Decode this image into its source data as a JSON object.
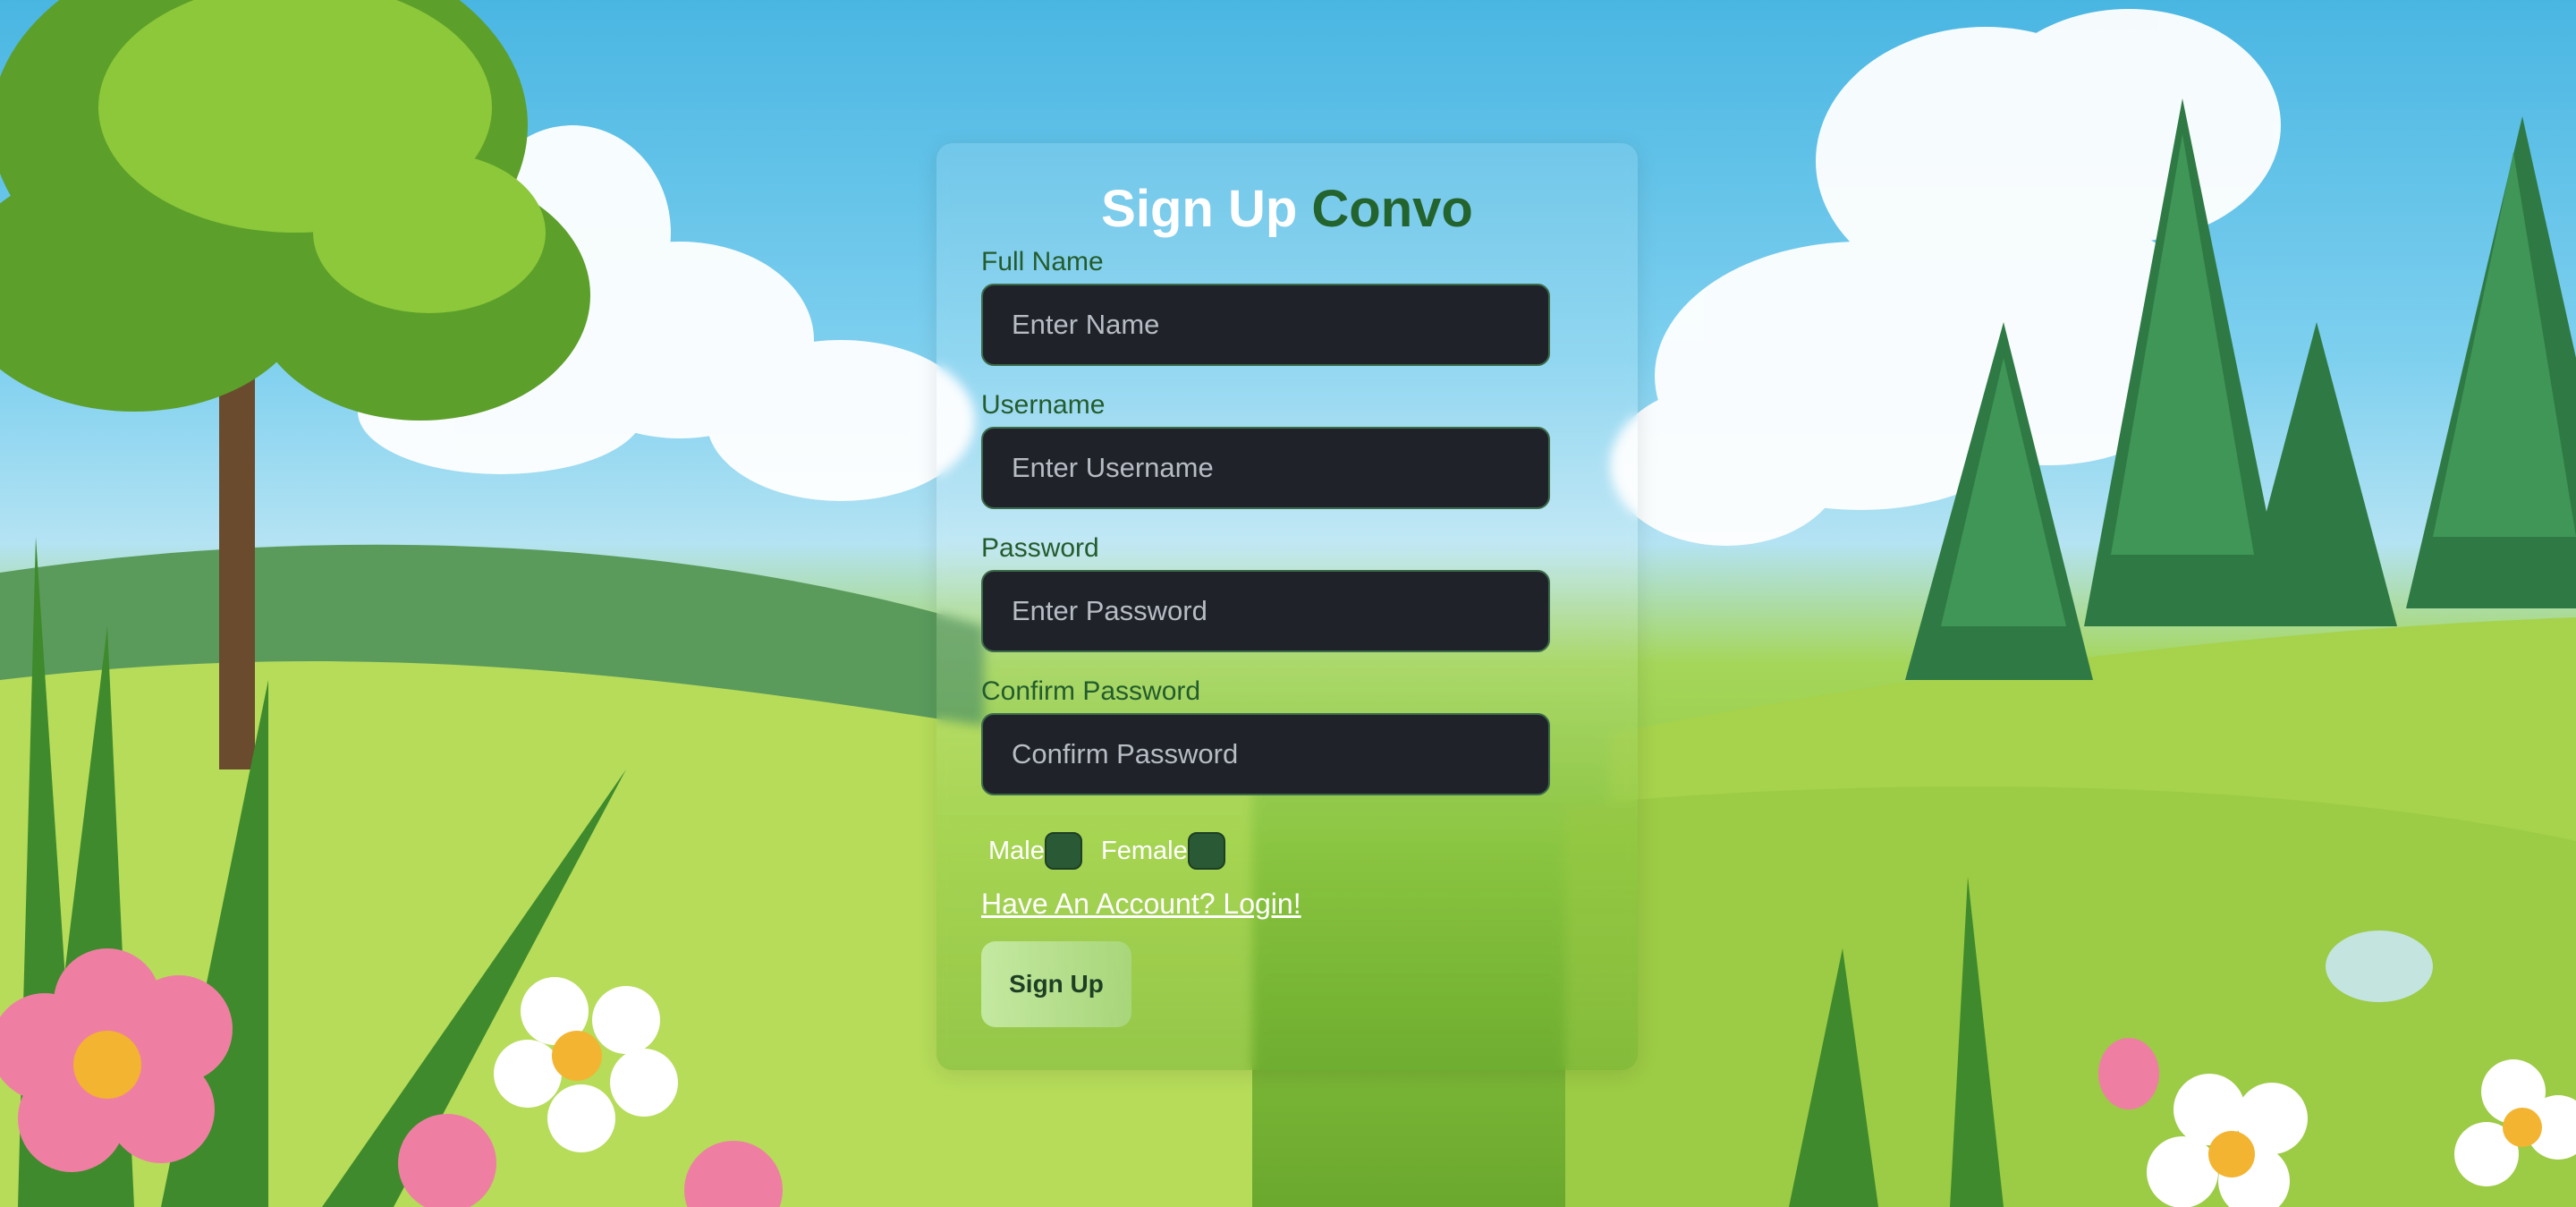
{
  "form": {
    "title_main": "Sign Up",
    "title_brand": "Convo",
    "fields": [
      {
        "label": "Full Name",
        "placeholder": "Enter Name"
      },
      {
        "label": "Username",
        "placeholder": "Enter Username"
      },
      {
        "label": "Password",
        "placeholder": "Enter Password"
      },
      {
        "label": "Confirm Password",
        "placeholder": "Confirm Password"
      }
    ],
    "gender": {
      "male_label": "Male",
      "female_label": "Female"
    },
    "login_link": "Have An Account? Login!",
    "submit_label": "Sign Up"
  },
  "colors": {
    "brand": "#23632e",
    "input_bg": "#1f2329",
    "label": "#235c2d"
  }
}
